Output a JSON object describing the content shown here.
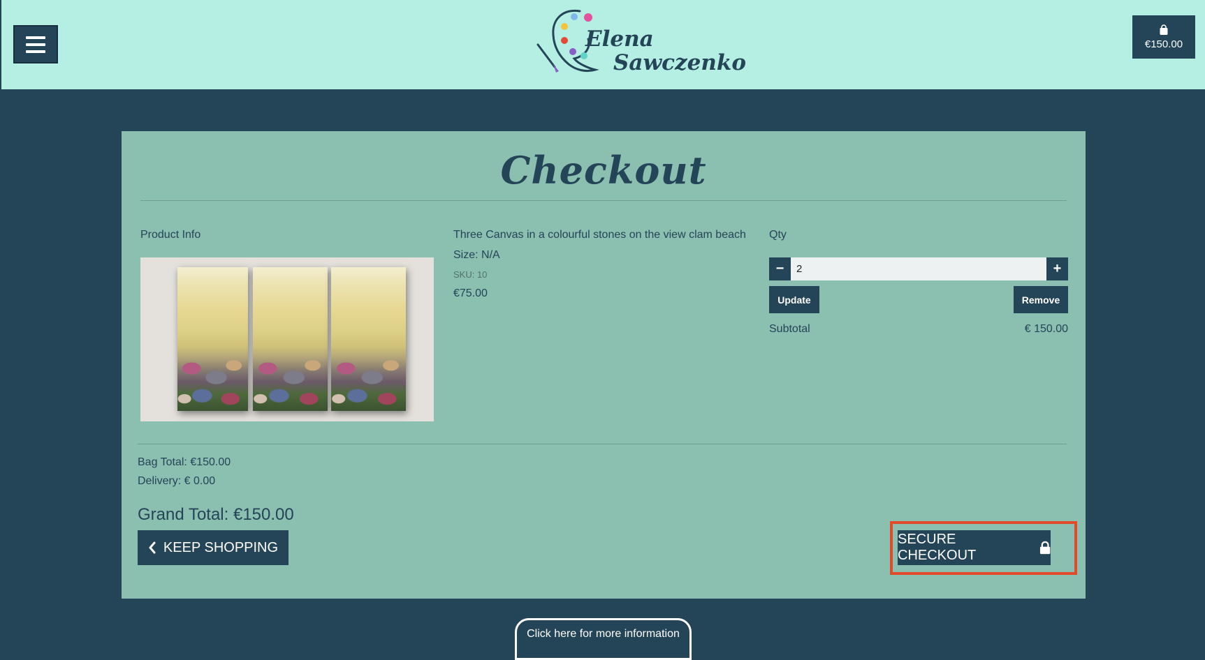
{
  "header": {
    "menu_icon": "hamburger-menu-icon",
    "logo": {
      "line1": "Elena",
      "line2": "Sawczenko",
      "icon": "palette-brush-logo"
    },
    "cart": {
      "icon": "shopping-bag-icon",
      "total": "€150.00"
    }
  },
  "page": {
    "title": "Checkout"
  },
  "product": {
    "section_label": "Product Info",
    "image_alt": "Three canvas painting of colourful stones on the beach",
    "name": "Three Canvas in a colourful stones on the view clam beach",
    "size": "Size: N/A",
    "sku": "SKU: 10",
    "price": "€75.00"
  },
  "qty": {
    "label": "Qty",
    "decrement": "−",
    "increment": "+",
    "value": "2",
    "update_label": "Update",
    "remove_label": "Remove",
    "subtotal_label": "Subtotal",
    "subtotal_value": "€ 150.00"
  },
  "totals": {
    "bag_total": "Bag Total: €150.00",
    "delivery": "Delivery: € 0.00",
    "grand_total": "Grand Total: €150.00"
  },
  "actions": {
    "keep_shopping": "KEEP SHOPPING",
    "secure_checkout": "SECURE CHECKOUT"
  },
  "footer": {
    "info_tab": "Click here for more information"
  },
  "colors": {
    "header_bg": "#b5efe3",
    "page_bg": "#244458",
    "card_bg": "#8bbfb0",
    "highlight": "#e14a2b"
  }
}
